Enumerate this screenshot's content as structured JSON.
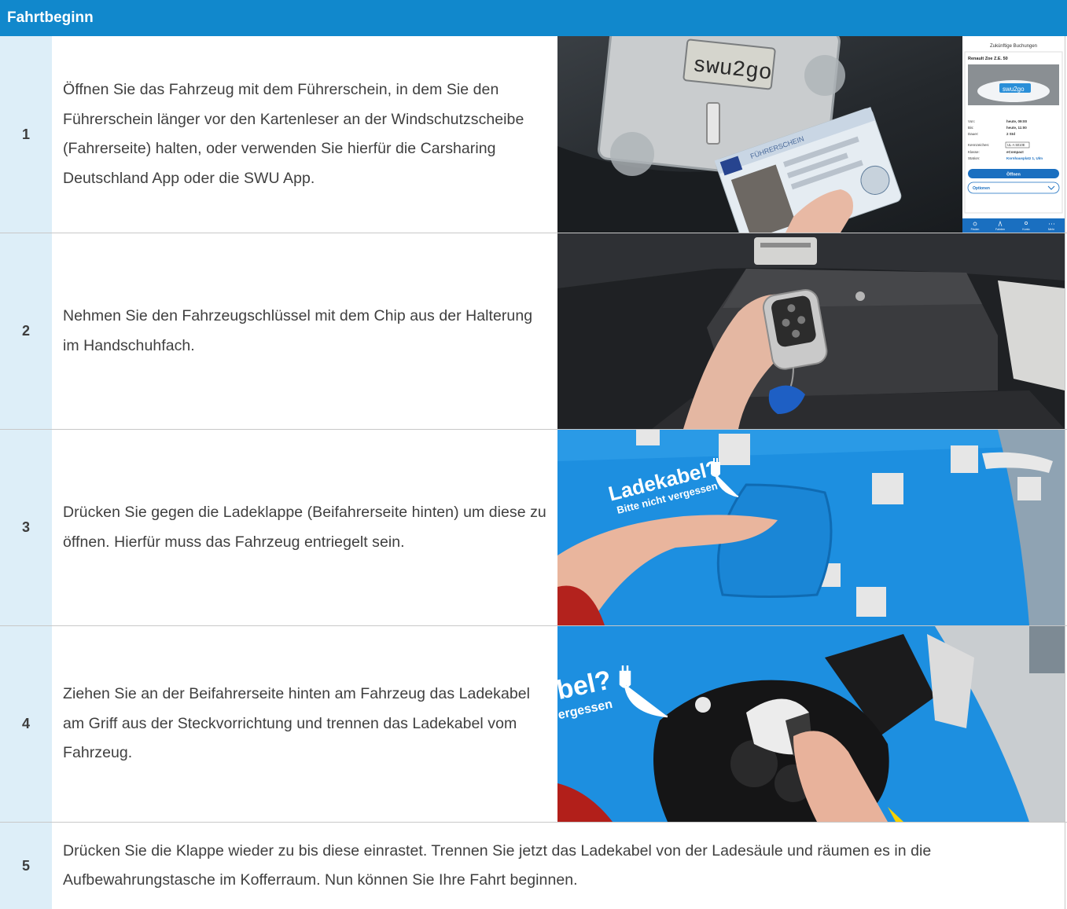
{
  "header": {
    "title": "Fahrtbeginn"
  },
  "steps": [
    {
      "number": "1",
      "text": "Öffnen Sie das Fahrzeug mit dem Führerschein, in dem Sie den Führerschein länger vor den Kartenleser an der Windschutzscheibe (Fahrerseite) halten, oder verwenden Sie hierfür die Carsharing Deutschland App oder die SWU App."
    },
    {
      "number": "2",
      "text": "Nehmen Sie den Fahrzeugschlüssel mit dem Chip aus der Halte­rung im Handschuhfach."
    },
    {
      "number": "3",
      "text": "Drücken Sie gegen die Ladeklappe (Beifahrerseite hinten) um diese zu öffnen. Hierfür muss das Fahrzeug entriegelt sein."
    },
    {
      "number": "4",
      "text": "Ziehen Sie an der Beifahrerseite hinten am Fahrzeug das Ladeka­bel am Griff aus der Steckvorrichtung und trennen das Ladekabel vom Fahrzeug."
    },
    {
      "number": "5",
      "text": "Drücken Sie die Klappe wieder zu bis diese einrastet. Trennen Sie jetzt das Ladekabel von der Ladesäule und räumen es in die Aufbewahrungstasche im Kofferraum. Nun können Sie Ihre Fahrt beginnen."
    }
  ],
  "photo1": {
    "reader_label": "swu2go",
    "license_title": "FÜHRERSCHEIN",
    "app": {
      "header": "Zukünftige Buchungen",
      "car_name": "Renault Zoe Z.E. 50",
      "car_brand": "swu2go",
      "details": [
        {
          "label": "Von:",
          "value": "heute, 09:00"
        },
        {
          "label": "Bis:",
          "value": "heute, 11:00"
        },
        {
          "label": "Dauer:",
          "value": "2 Std"
        },
        {
          "label": "Kennzeichen:",
          "value": "UL-A 5010E"
        },
        {
          "label": "Klasse:",
          "value": "eCompact"
        },
        {
          "label": "Station:",
          "value": "Kornhausplatz 1, Ulm"
        }
      ],
      "open_button": "Öffnen",
      "options_button": "Optionen",
      "nav": [
        "Finden",
        "Fahrten",
        "Konto",
        "Mehr"
      ]
    }
  },
  "photo3": {
    "sticker_title": "Ladekabel?",
    "sticker_sub": "Bitte nicht vergessen"
  },
  "photo4": {
    "sticker_title": "bel?",
    "sticker_sub": "ergessen"
  }
}
